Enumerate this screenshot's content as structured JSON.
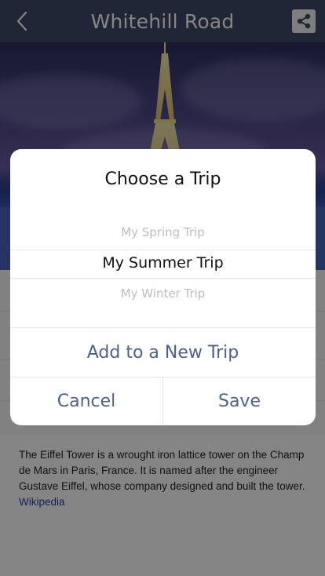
{
  "navbar": {
    "title": "Whitehill Road",
    "back_icon": "chevron-left-icon",
    "share_icon": "share-icon"
  },
  "description": {
    "text": "The Eiffel Tower is a wrought iron lattice tower on the Champ de Mars in Paris, France. It is named after the engineer Gustave Eiffel, whose company designed and built the tower.",
    "link_label": "Wikipedia"
  },
  "dialog": {
    "title": "Choose a Trip",
    "options": [
      {
        "label": "My Spring Trip",
        "state": "faded"
      },
      {
        "label": "My Summer Trip",
        "state": "selected"
      },
      {
        "label": "My Winter Trip",
        "state": "faded"
      }
    ],
    "add_new_label": "Add to a New Trip",
    "cancel_label": "Cancel",
    "save_label": "Save"
  },
  "colors": {
    "navbar_bg": "#3f4967",
    "accent_text": "#4e6189",
    "link": "#2a3fa8"
  }
}
